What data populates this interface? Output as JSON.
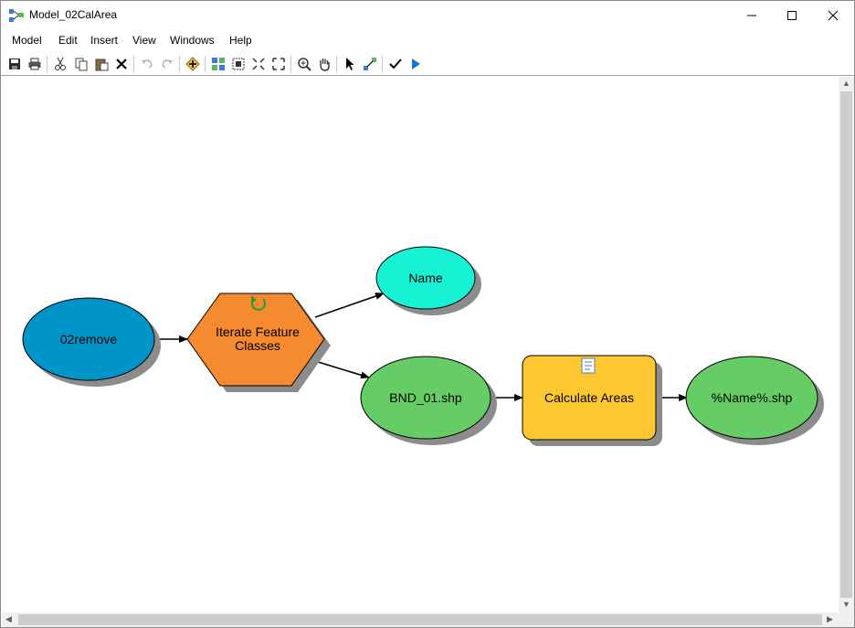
{
  "window": {
    "title": "Model_02CalArea"
  },
  "menu": [
    "Model",
    "Edit",
    "Insert",
    "View",
    "Windows",
    "Help"
  ],
  "toolbar_icons": [
    "save-icon",
    "print-icon",
    "cut-icon",
    "copy-icon",
    "paste-icon",
    "delete-icon",
    "undo-icon",
    "redo-icon",
    "add-data-icon",
    "auto-layout-icon",
    "full-extent-icon",
    "fixed-zoom-in-icon",
    "fixed-zoom-out-icon",
    "zoom-in-icon",
    "pan-icon",
    "select-icon",
    "connect-icon",
    "validate-icon",
    "run-icon"
  ],
  "diagram": {
    "nodes": {
      "input": {
        "label": "02remove",
        "color": "#0095c8"
      },
      "iterator": {
        "label_line1": "Iterate Feature",
        "label_line2": "Classes",
        "color": "#f58a30"
      },
      "name_var": {
        "label": "Name",
        "color": "#17f2d5"
      },
      "bnd": {
        "label": "BND_01.shp",
        "color": "#66cc66"
      },
      "tool": {
        "label": "Calculate Areas",
        "color": "#fdc82f"
      },
      "output": {
        "label": "%Name%.shp",
        "color": "#66cc66"
      }
    }
  }
}
